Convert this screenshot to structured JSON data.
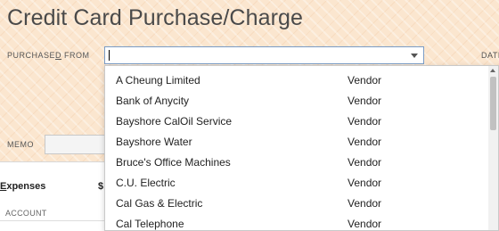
{
  "window": {
    "title": "Credit Card Purchase/Charge"
  },
  "form": {
    "purchased_from_label_pre": "PURCHASE",
    "purchased_from_label_ul": "D",
    "purchased_from_label_post": " FROM",
    "purchased_from_value": "",
    "date_label": "DATE",
    "memo_label": "MEMO",
    "memo_value": ""
  },
  "expenses": {
    "tab_label_ul": "E",
    "tab_label_rest": "xpenses",
    "amount_prefix": "$",
    "columns": [
      "ACCOUNT"
    ]
  },
  "dropdown": {
    "items": [
      {
        "name": "A Cheung Limited",
        "type": "Vendor"
      },
      {
        "name": "Bank of Anycity",
        "type": "Vendor"
      },
      {
        "name": "Bayshore CalOil Service",
        "type": "Vendor"
      },
      {
        "name": "Bayshore Water",
        "type": "Vendor"
      },
      {
        "name": "Bruce's Office Machines",
        "type": "Vendor"
      },
      {
        "name": "C.U. Electric",
        "type": "Vendor"
      },
      {
        "name": "Cal Gas & Electric",
        "type": "Vendor"
      },
      {
        "name": "Cal Telephone",
        "type": "Vendor"
      }
    ]
  },
  "colors": {
    "background": "#fbe6cf",
    "combo_border": "#7a9cc6"
  }
}
